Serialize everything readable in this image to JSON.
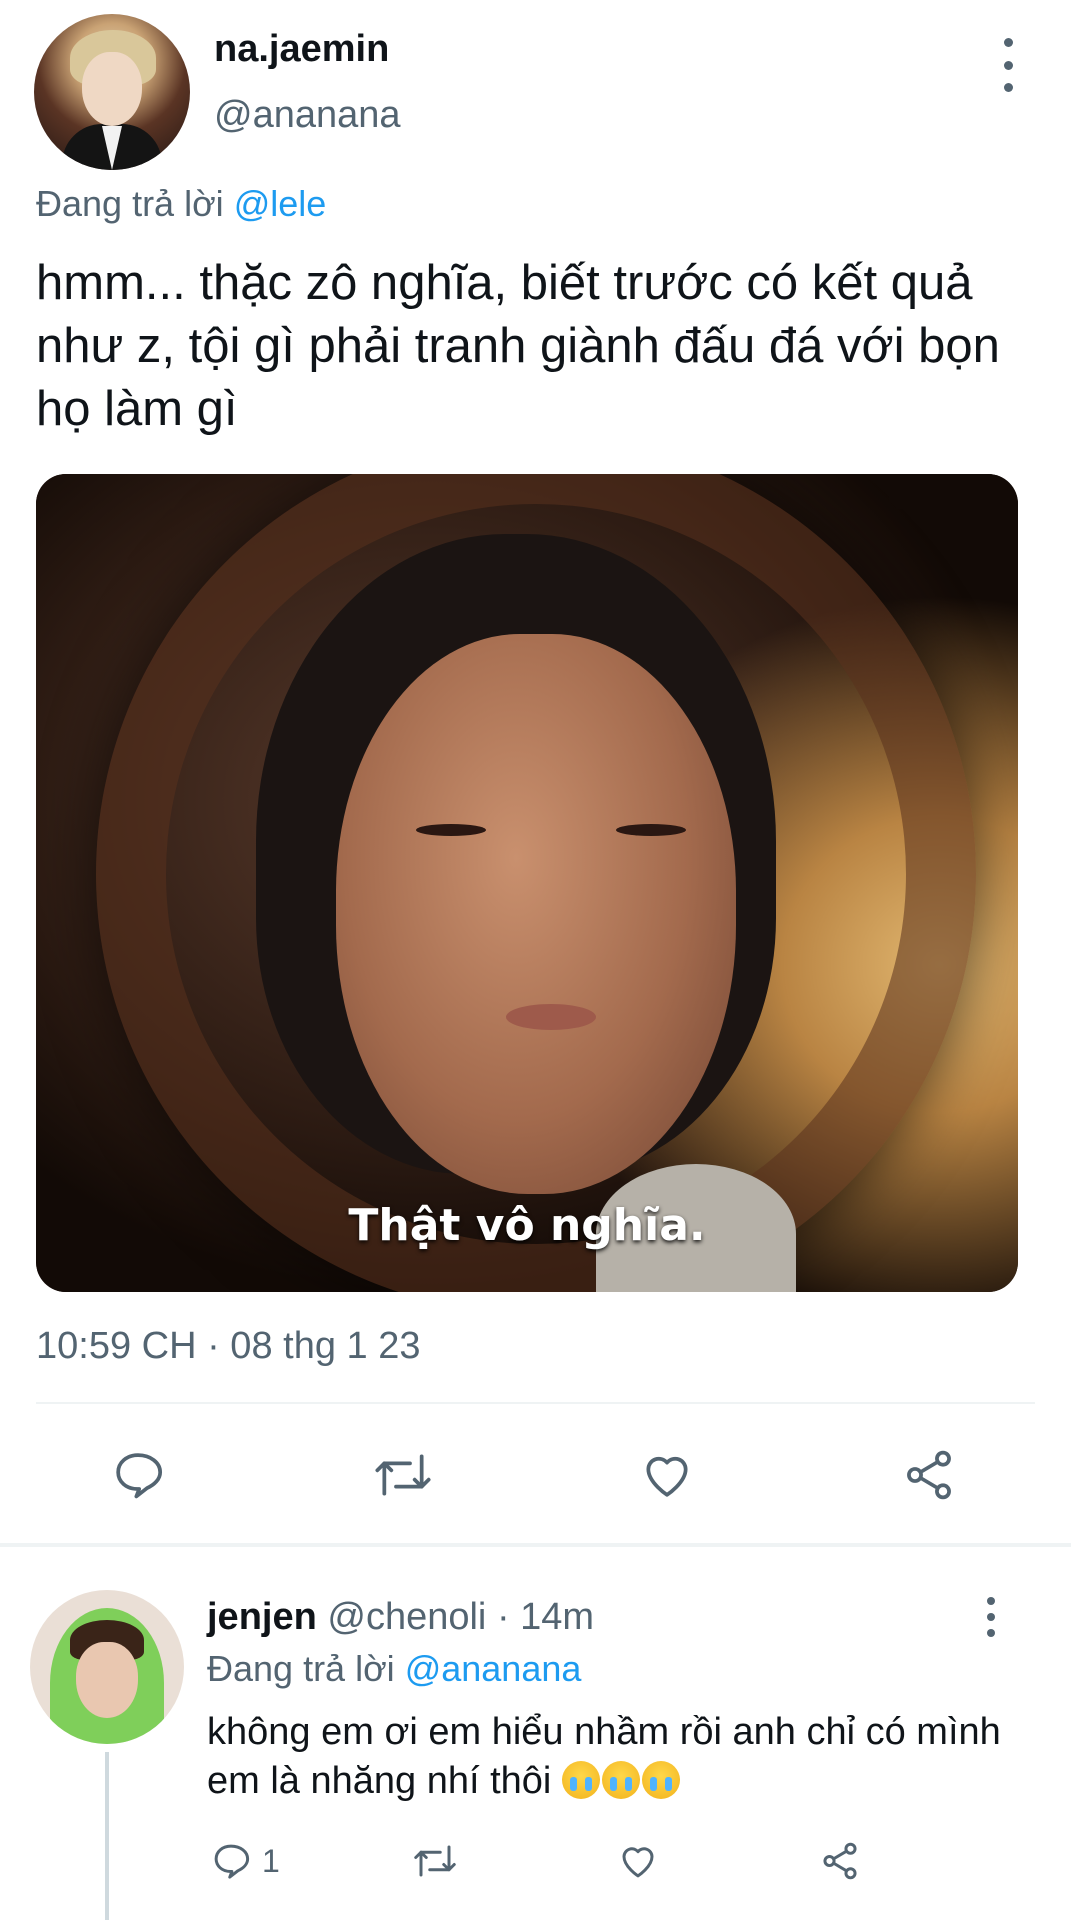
{
  "tweet": {
    "display_name": "na.jaemin",
    "handle": "@ananana",
    "reply_prefix": "Đang trả lời ",
    "reply_mention": "@lele",
    "text": "hmm... thặc zô nghĩa, biết trước có kết quả như z, tội gì phải tranh giành đấu đá với bọn họ làm gì",
    "media_caption": "Thật vô nghĩa.",
    "timestamp": "10:59 CH · 08 thg 1 23",
    "actions": [
      "reply-icon",
      "retweet-icon",
      "like-icon",
      "share-icon"
    ]
  },
  "reply": {
    "display_name": "jenjen",
    "handle": "@chenoli",
    "time": "· 14m",
    "reply_prefix": "Đang trả lời ",
    "reply_mention": "@ananana",
    "text": "không em ơi em hiểu nhầm rồi anh chỉ có mình em là nhăng nhí thôi",
    "emoji": [
      "loudly-crying-face",
      "loudly-crying-face",
      "loudly-crying-face"
    ],
    "reply_count": "1"
  },
  "colors": {
    "text": "#0f1419",
    "secondary": "#536471",
    "accent": "#1d9bf0",
    "divider": "#eff3f4"
  }
}
